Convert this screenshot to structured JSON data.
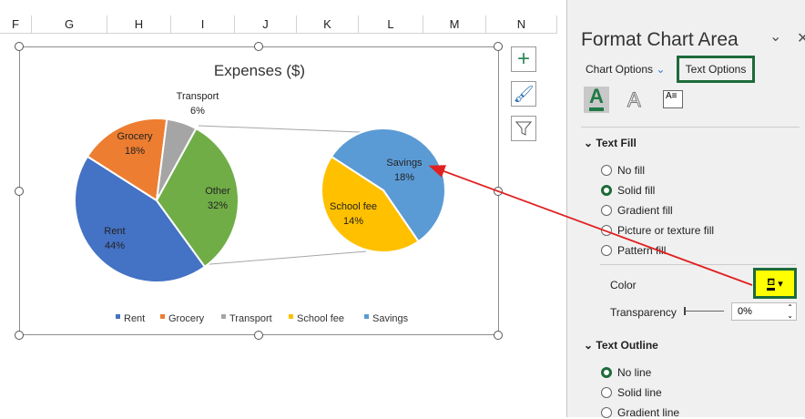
{
  "columns": [
    "F",
    "G",
    "H",
    "I",
    "J",
    "K",
    "L",
    "M",
    "N"
  ],
  "chart": {
    "title": "Expenses ($)",
    "main_pie": [
      {
        "name": "Rent",
        "value": 44,
        "label": "44%",
        "color": "#4472c4"
      },
      {
        "name": "Grocery",
        "value": 18,
        "label": "18%",
        "color": "#ed7d31"
      },
      {
        "name": "Transport",
        "value": 6,
        "label": "6%",
        "color": "#a5a5a5"
      },
      {
        "name": "Other",
        "value": 32,
        "label": "32%",
        "color": "#70ad47"
      }
    ],
    "secondary_pie": [
      {
        "name": "Savings",
        "value": 18,
        "label": "18%",
        "color": "#5b9bd5"
      },
      {
        "name": "School fee",
        "value": 14,
        "label": "14%",
        "color": "#ffc000"
      }
    ],
    "legend": [
      {
        "name": "Rent",
        "color": "#4472c4"
      },
      {
        "name": "Grocery",
        "color": "#ed7d31"
      },
      {
        "name": "Transport",
        "color": "#a5a5a5"
      },
      {
        "name": "School fee",
        "color": "#ffc000"
      },
      {
        "name": "Savings",
        "color": "#5b9bd5"
      }
    ]
  },
  "pane": {
    "title": "Format Chart Area",
    "chart_options": "Chart Options",
    "text_options": "Text Options",
    "text_fill": "Text Fill",
    "fill_options": [
      "No fill",
      "Solid fill",
      "Gradient fill",
      "Picture or texture fill",
      "Pattern fill"
    ],
    "fill_selected": 1,
    "color_label": "Color",
    "transparency_label": "Transparency",
    "transparency_value": "0%",
    "text_outline": "Text Outline",
    "outline_options": [
      "No line",
      "Solid line",
      "Gradient line"
    ],
    "outline_selected": 0,
    "highlight_color": "#1d6b3a",
    "annotation_arrow_color": "#e02020"
  }
}
